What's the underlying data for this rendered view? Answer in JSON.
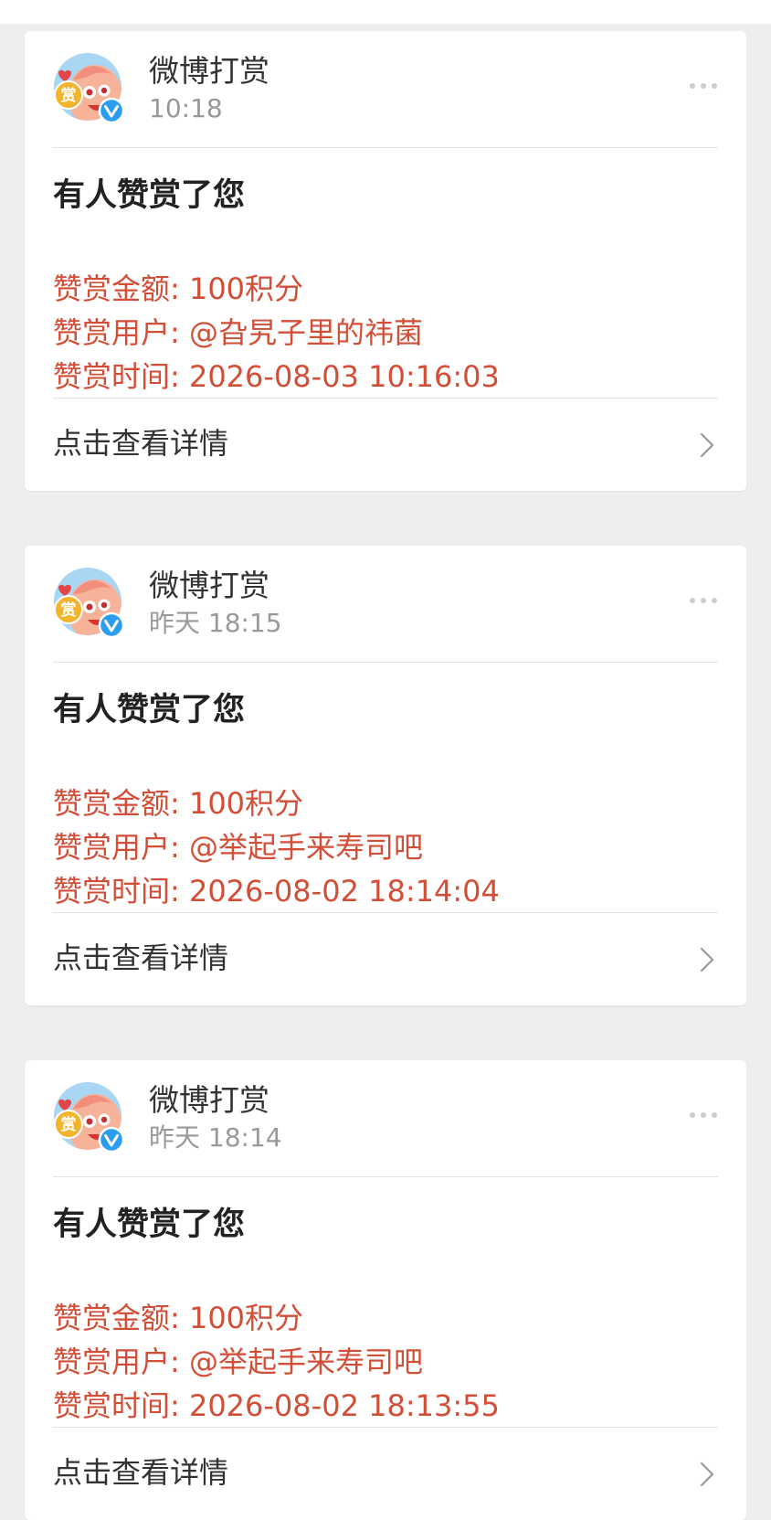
{
  "colors": {
    "background": "#eeeeee",
    "card": "#ffffff",
    "accent_red": "#d24e36",
    "title_text": "#222222",
    "muted_text": "#999999",
    "verified_blue": "#2b9df0"
  },
  "icons": {
    "more": "more-dots-icon",
    "chevron": "chevron-right-icon",
    "verified": "verified-badge-icon",
    "avatar_badge_text": "赏"
  },
  "cards": [
    {
      "sender": "微博打赏",
      "time": "10:18",
      "title": "有人赞赏了您",
      "amount": "赞赏金额: 100积分",
      "user": "赞赏用户: @旮旯子里的祎菌",
      "reward_time": "赞赏时间: 2026-08-03 10:16:03",
      "action_label": "点击查看详情"
    },
    {
      "sender": "微博打赏",
      "time": "昨天 18:15",
      "title": "有人赞赏了您",
      "amount": "赞赏金额: 100积分",
      "user": "赞赏用户: @举起手来寿司吧",
      "reward_time": "赞赏时间: 2026-08-02 18:14:04",
      "action_label": "点击查看详情"
    },
    {
      "sender": "微博打赏",
      "time": "昨天 18:14",
      "title": "有人赞赏了您",
      "amount": "赞赏金额: 100积分",
      "user": "赞赏用户: @举起手来寿司吧",
      "reward_time": "赞赏时间: 2026-08-02 18:13:55",
      "action_label": "点击查看详情"
    }
  ]
}
